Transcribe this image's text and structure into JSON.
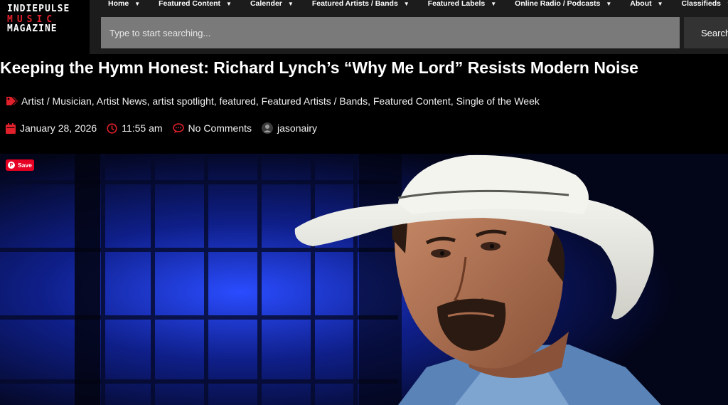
{
  "logo": {
    "line1": "INDIEPULSE",
    "line2": "MUSIC",
    "line3": "MAGAZINE"
  },
  "nav": {
    "items": [
      {
        "label": "Home"
      },
      {
        "label": "Featured Content"
      },
      {
        "label": "Calender"
      },
      {
        "label": "Featured Artists / Bands"
      },
      {
        "label": "Featured Labels"
      },
      {
        "label": "Online Radio / Podcasts"
      },
      {
        "label": "About"
      },
      {
        "label": "Classifieds"
      }
    ]
  },
  "search": {
    "placeholder": "Type to start searching...",
    "button_label": "Search"
  },
  "article": {
    "title": "Keeping the Hymn Honest: Richard Lynch’s “Why Me Lord” Resists Modern Noise",
    "categories": "Artist / Musician, Artist News, artist spotlight, featured, Featured Artists / Bands, Featured Content, Single of the Week",
    "date": "January 28, 2026",
    "time": "11:55 am",
    "comments": "No Comments",
    "author": "jasonairy",
    "save_label": "Save"
  },
  "colors": {
    "accent": "#e0202a",
    "nav_bg": "#1c1c1c",
    "search_bg": "#7a7a7a",
    "pinterest": "#e60023"
  }
}
